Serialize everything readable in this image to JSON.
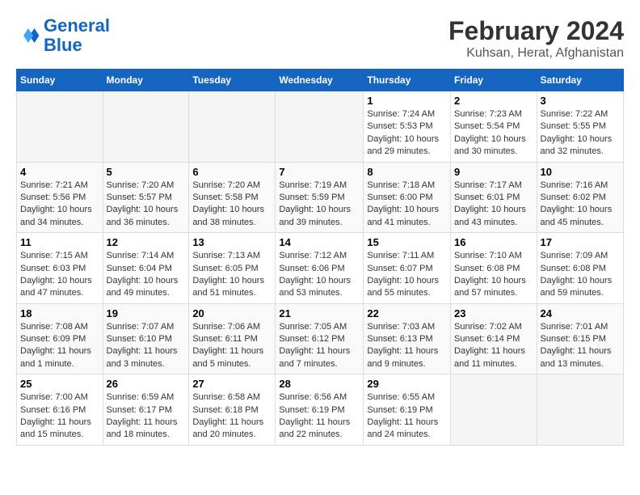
{
  "logo": {
    "line1": "General",
    "line2": "Blue"
  },
  "title": "February 2024",
  "subtitle": "Kuhsan, Herat, Afghanistan",
  "headers": [
    "Sunday",
    "Monday",
    "Tuesday",
    "Wednesday",
    "Thursday",
    "Friday",
    "Saturday"
  ],
  "weeks": [
    [
      {
        "num": "",
        "info": ""
      },
      {
        "num": "",
        "info": ""
      },
      {
        "num": "",
        "info": ""
      },
      {
        "num": "",
        "info": ""
      },
      {
        "num": "1",
        "info": "Sunrise: 7:24 AM\nSunset: 5:53 PM\nDaylight: 10 hours\nand 29 minutes."
      },
      {
        "num": "2",
        "info": "Sunrise: 7:23 AM\nSunset: 5:54 PM\nDaylight: 10 hours\nand 30 minutes."
      },
      {
        "num": "3",
        "info": "Sunrise: 7:22 AM\nSunset: 5:55 PM\nDaylight: 10 hours\nand 32 minutes."
      }
    ],
    [
      {
        "num": "4",
        "info": "Sunrise: 7:21 AM\nSunset: 5:56 PM\nDaylight: 10 hours\nand 34 minutes."
      },
      {
        "num": "5",
        "info": "Sunrise: 7:20 AM\nSunset: 5:57 PM\nDaylight: 10 hours\nand 36 minutes."
      },
      {
        "num": "6",
        "info": "Sunrise: 7:20 AM\nSunset: 5:58 PM\nDaylight: 10 hours\nand 38 minutes."
      },
      {
        "num": "7",
        "info": "Sunrise: 7:19 AM\nSunset: 5:59 PM\nDaylight: 10 hours\nand 39 minutes."
      },
      {
        "num": "8",
        "info": "Sunrise: 7:18 AM\nSunset: 6:00 PM\nDaylight: 10 hours\nand 41 minutes."
      },
      {
        "num": "9",
        "info": "Sunrise: 7:17 AM\nSunset: 6:01 PM\nDaylight: 10 hours\nand 43 minutes."
      },
      {
        "num": "10",
        "info": "Sunrise: 7:16 AM\nSunset: 6:02 PM\nDaylight: 10 hours\nand 45 minutes."
      }
    ],
    [
      {
        "num": "11",
        "info": "Sunrise: 7:15 AM\nSunset: 6:03 PM\nDaylight: 10 hours\nand 47 minutes."
      },
      {
        "num": "12",
        "info": "Sunrise: 7:14 AM\nSunset: 6:04 PM\nDaylight: 10 hours\nand 49 minutes."
      },
      {
        "num": "13",
        "info": "Sunrise: 7:13 AM\nSunset: 6:05 PM\nDaylight: 10 hours\nand 51 minutes."
      },
      {
        "num": "14",
        "info": "Sunrise: 7:12 AM\nSunset: 6:06 PM\nDaylight: 10 hours\nand 53 minutes."
      },
      {
        "num": "15",
        "info": "Sunrise: 7:11 AM\nSunset: 6:07 PM\nDaylight: 10 hours\nand 55 minutes."
      },
      {
        "num": "16",
        "info": "Sunrise: 7:10 AM\nSunset: 6:08 PM\nDaylight: 10 hours\nand 57 minutes."
      },
      {
        "num": "17",
        "info": "Sunrise: 7:09 AM\nSunset: 6:08 PM\nDaylight: 10 hours\nand 59 minutes."
      }
    ],
    [
      {
        "num": "18",
        "info": "Sunrise: 7:08 AM\nSunset: 6:09 PM\nDaylight: 11 hours\nand 1 minute."
      },
      {
        "num": "19",
        "info": "Sunrise: 7:07 AM\nSunset: 6:10 PM\nDaylight: 11 hours\nand 3 minutes."
      },
      {
        "num": "20",
        "info": "Sunrise: 7:06 AM\nSunset: 6:11 PM\nDaylight: 11 hours\nand 5 minutes."
      },
      {
        "num": "21",
        "info": "Sunrise: 7:05 AM\nSunset: 6:12 PM\nDaylight: 11 hours\nand 7 minutes."
      },
      {
        "num": "22",
        "info": "Sunrise: 7:03 AM\nSunset: 6:13 PM\nDaylight: 11 hours\nand 9 minutes."
      },
      {
        "num": "23",
        "info": "Sunrise: 7:02 AM\nSunset: 6:14 PM\nDaylight: 11 hours\nand 11 minutes."
      },
      {
        "num": "24",
        "info": "Sunrise: 7:01 AM\nSunset: 6:15 PM\nDaylight: 11 hours\nand 13 minutes."
      }
    ],
    [
      {
        "num": "25",
        "info": "Sunrise: 7:00 AM\nSunset: 6:16 PM\nDaylight: 11 hours\nand 15 minutes."
      },
      {
        "num": "26",
        "info": "Sunrise: 6:59 AM\nSunset: 6:17 PM\nDaylight: 11 hours\nand 18 minutes."
      },
      {
        "num": "27",
        "info": "Sunrise: 6:58 AM\nSunset: 6:18 PM\nDaylight: 11 hours\nand 20 minutes."
      },
      {
        "num": "28",
        "info": "Sunrise: 6:56 AM\nSunset: 6:19 PM\nDaylight: 11 hours\nand 22 minutes."
      },
      {
        "num": "29",
        "info": "Sunrise: 6:55 AM\nSunset: 6:19 PM\nDaylight: 11 hours\nand 24 minutes."
      },
      {
        "num": "",
        "info": ""
      },
      {
        "num": "",
        "info": ""
      }
    ]
  ]
}
